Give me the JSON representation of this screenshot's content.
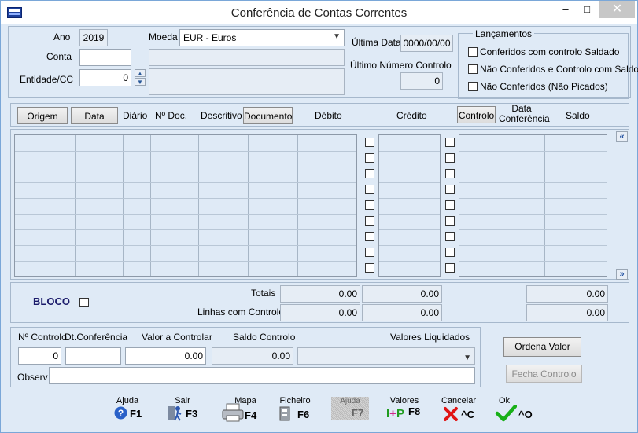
{
  "window": {
    "title": "Conferência de Contas Correntes",
    "minimize": "–",
    "maximize": "□",
    "close": "✕"
  },
  "top": {
    "ano_label": "Ano",
    "ano_value": "2019",
    "moeda_label": "Moeda",
    "moeda_value": "EUR - Euros",
    "conta_label": "Conta",
    "conta_value": "",
    "entidade_label": "Entidade/CC",
    "entidade_value": "0",
    "ultima_data_label": "Última Data",
    "ultima_data_value": "0000/00/00",
    "ultimo_numero_label": "Último Número Controlo",
    "ultimo_numero_value": "0"
  },
  "lancamentos": {
    "title": "Lançamentos",
    "options": [
      {
        "label": "Conferidos com controlo Saldado",
        "checked": false
      },
      {
        "label": "Não Conferidos e Controlo com Saldo",
        "checked": false
      },
      {
        "label": "Não Conferidos (Não Picados)",
        "checked": false
      }
    ]
  },
  "columns": {
    "origem": "Origem",
    "data": "Data",
    "diario": "Diário",
    "n_doc": "Nº Doc.",
    "descritivo": "Descritivo",
    "documento": "Documento",
    "debito": "Débito",
    "credito": "Crédito",
    "controlo": "Controlo",
    "data_conferencia": "Data Conferência",
    "saldo": "Saldo"
  },
  "grid": {
    "rows": 9
  },
  "totals": {
    "bloco_label": "BLOCO",
    "totais_label": "Totais",
    "totais_debito": "0.00",
    "totais_credito": "0.00",
    "totais_saldo": "0.00",
    "linhas_label": "Linhas com Controlo",
    "linhas_debito": "0.00",
    "linhas_credito": "0.00",
    "linhas_saldo": "0.00"
  },
  "controlo": {
    "n_controlo_label": "Nº Controlo",
    "n_controlo_value": "0",
    "dt_conferencia_label": "Dt.Conferência",
    "dt_conferencia_value": "",
    "valor_controlar_label": "Valor a Controlar",
    "valor_controlar_value": "0.00",
    "saldo_controlo_label": "Saldo Controlo",
    "saldo_controlo_value": "0.00",
    "valores_liquidados_label": "Valores Liquidados",
    "valores_liquidados_value": "",
    "observ_label": "Observ",
    "observ_value": "",
    "ordena_valor": "Ordena Valor",
    "fecha_controlo": "Fecha Controlo"
  },
  "fkeys": [
    {
      "caption": "Ajuda",
      "key": "F1",
      "icon": "help-icon"
    },
    {
      "caption": "Sair",
      "key": "F3",
      "icon": "exit-icon"
    },
    {
      "caption": "Mapa",
      "key": "F4",
      "icon": "printer-icon"
    },
    {
      "caption": "Ficheiro",
      "key": "F6",
      "icon": "file-icon"
    },
    {
      "caption": "Ajuda",
      "key": "F7",
      "icon": "help-disabled-icon"
    },
    {
      "caption": "Valores",
      "key": "F8",
      "icon": "values-icon"
    },
    {
      "caption": "Cancelar",
      "key": "^C",
      "icon": "cancel-icon"
    },
    {
      "caption": "Ok",
      "key": "^O",
      "icon": "ok-icon"
    }
  ]
}
